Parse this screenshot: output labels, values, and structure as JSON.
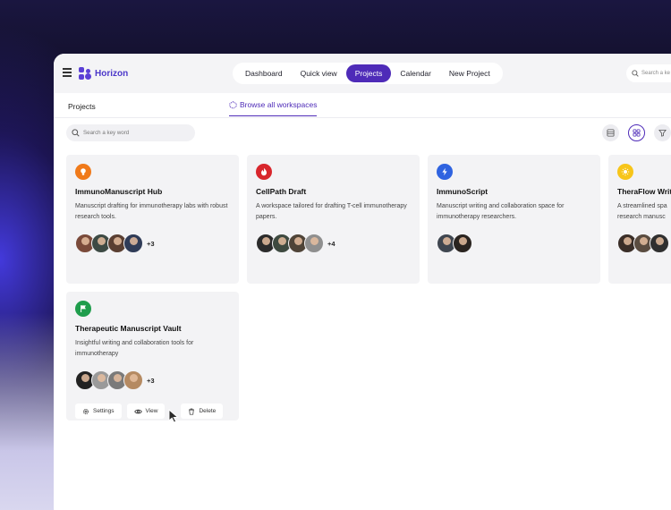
{
  "app": {
    "brand": "Horizon",
    "nav": [
      "Dashboard",
      "Quick view",
      "Projects",
      "Calendar",
      "New Project"
    ],
    "nav_active": "Projects",
    "top_search_placeholder": "Search a ke"
  },
  "subbar": {
    "projects_label": "Projects",
    "browse_label": "Browse all workspaces"
  },
  "toolbar": {
    "search_placeholder": "Search a key word",
    "list_view_icon": "list-icon",
    "grid_view_icon": "grid-icon",
    "filter_icon": "filter-icon"
  },
  "colors": {
    "accent": "#4e2bb8",
    "card_icon_orange": "#f07a1a",
    "card_icon_red": "#d8262c",
    "card_icon_blue": "#2f63e0",
    "card_icon_yellow": "#f7c51a",
    "card_icon_green": "#1f9d4c"
  },
  "cards": [
    {
      "title": "ImmunoManuscript Hub",
      "desc": "Manuscript drafting for immunotherapy labs with robust research tools.",
      "icon": "lightbulb-icon",
      "more": "+3"
    },
    {
      "title": "CellPath Draft",
      "desc": "A workspace tailored for drafting T-cell immunotherapy papers.",
      "icon": "flame-icon",
      "more": "+4"
    },
    {
      "title": "ImmunoScript",
      "desc": "Manuscript writing and collaboration space for immunotherapy researchers.",
      "icon": "lightning-icon",
      "more": ""
    },
    {
      "title": "TheraFlow Writi",
      "desc": "A streamlined spa research manusc",
      "icon": "sun-icon",
      "more": ""
    },
    {
      "title": "Therapeutic Manuscript Vault",
      "desc": "Insightful writing and collaboration tools for immunotherapy",
      "icon": "flag-icon",
      "more": "+3",
      "actions": [
        "Settings",
        "View",
        "Delete"
      ]
    }
  ]
}
